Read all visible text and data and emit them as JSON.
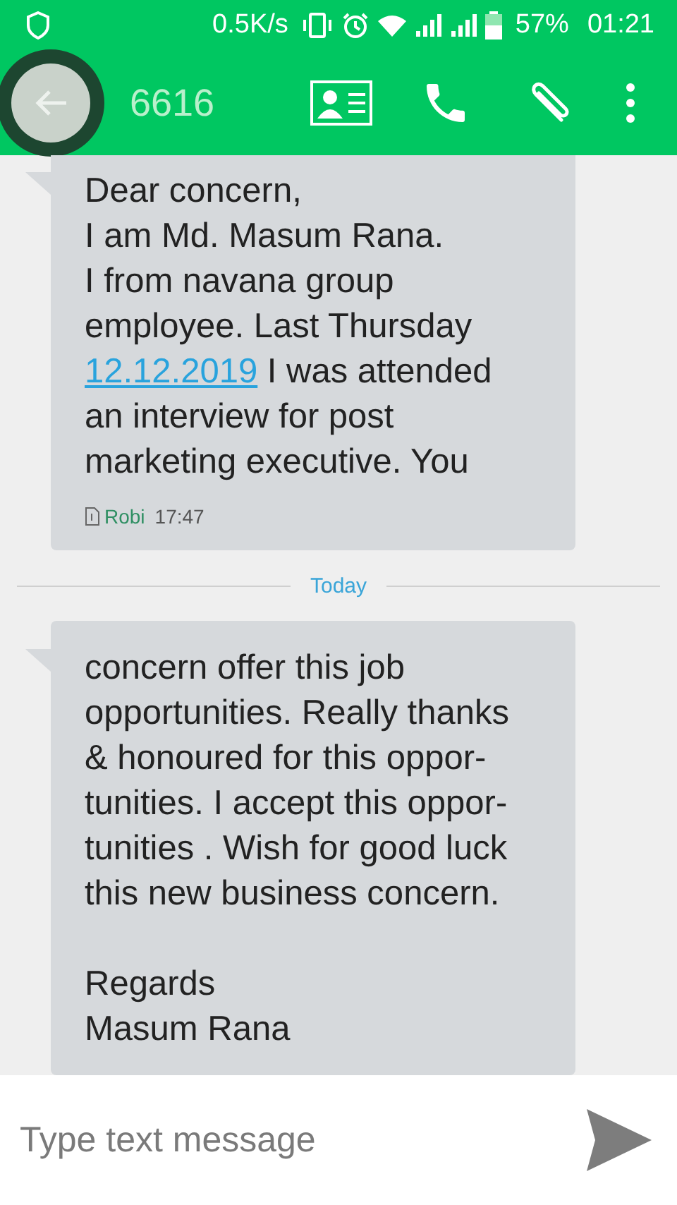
{
  "status_bar": {
    "speed": "0.5K/s",
    "battery": "57%",
    "time": "01:21"
  },
  "toolbar": {
    "title": "6616"
  },
  "messages": [
    {
      "parts": [
        {
          "kind": "text",
          "text": "Dear concern,\nI am Md. Masum Rana.\nI from navana group\nemployee. Last Thursday\n"
        },
        {
          "kind": "link",
          "text": "12.12.2019"
        },
        {
          "kind": "text",
          "text": " I was attended\nan interview for post\nmarketing executive. You"
        }
      ],
      "sim": "Robi",
      "time": "17:47"
    },
    {
      "parts": [
        {
          "kind": "text",
          "text": "concern offer this job\nopportunities. Really thanks\n& honoured for this oppor-\ntunities. I accept this oppor-\ntunities . Wish for good luck\nthis new business concern.\n\nRegards\nMasum Rana"
        }
      ]
    }
  ],
  "date_divider": "Today",
  "composer": {
    "placeholder": "Type text message"
  }
}
